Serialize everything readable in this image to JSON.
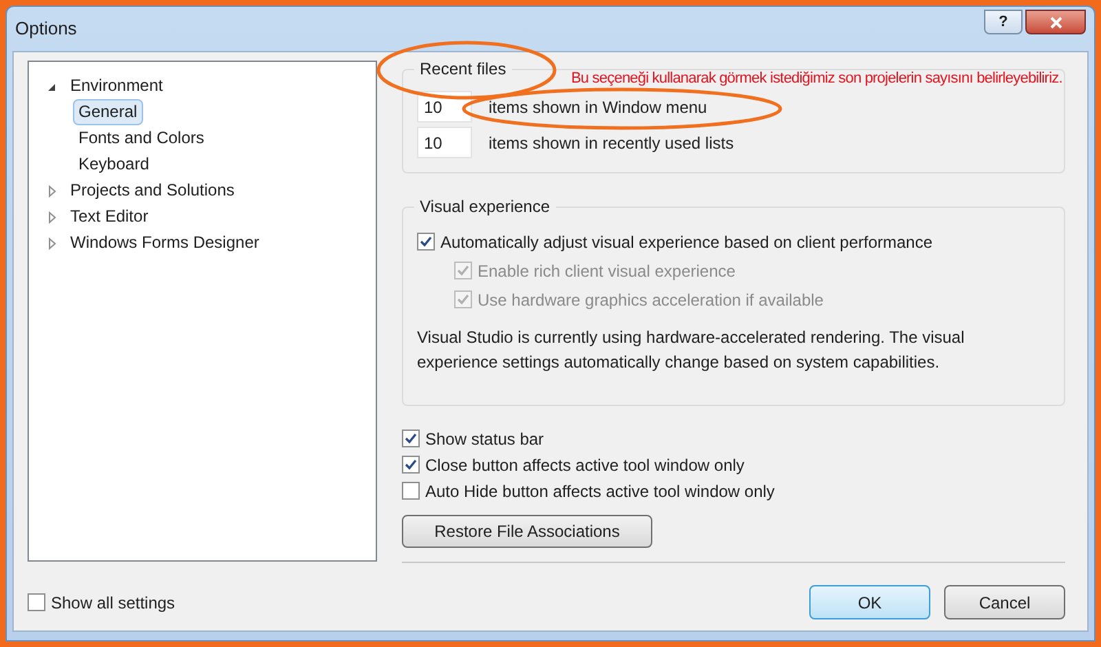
{
  "window": {
    "title": "Options",
    "help_button": "?"
  },
  "tree": [
    {
      "label": "Environment",
      "expanded": true,
      "selected": false,
      "children": [
        {
          "label": "General",
          "selected": true
        },
        {
          "label": "Fonts and Colors",
          "selected": false
        },
        {
          "label": "Keyboard",
          "selected": false
        }
      ]
    },
    {
      "label": "Projects and Solutions",
      "expanded": false,
      "selected": false
    },
    {
      "label": "Text Editor",
      "expanded": false,
      "selected": false
    },
    {
      "label": "Windows Forms Designer",
      "expanded": false,
      "selected": false
    }
  ],
  "recent_files": {
    "title": "Recent files",
    "rows": [
      {
        "value": "10",
        "label": "items shown in Window menu"
      },
      {
        "value": "10",
        "label": "items shown in recently used lists"
      }
    ]
  },
  "annotation": "Bu seçeneği kullanarak görmek istediğimiz son projelerin sayısını belirleyebiliriz.",
  "visual_experience": {
    "title": "Visual experience",
    "options": [
      {
        "label": "Automatically adjust visual experience based on client performance",
        "checked": true,
        "disabled": false,
        "indent": false
      },
      {
        "label": "Enable rich client visual experience",
        "checked": true,
        "disabled": true,
        "indent": true
      },
      {
        "label": "Use hardware graphics acceleration if available",
        "checked": true,
        "disabled": true,
        "indent": true
      }
    ],
    "note": "Visual Studio is currently using hardware-accelerated rendering. The visual experience settings automatically change based on system capabilities."
  },
  "options": [
    {
      "label": "Show status bar",
      "checked": true
    },
    {
      "label": "Close button affects active tool window only",
      "checked": true
    },
    {
      "label": "Auto Hide button affects active tool window only",
      "checked": false
    }
  ],
  "restore_button": "Restore File Associations",
  "show_all_settings": {
    "label": "Show all settings",
    "checked": false
  },
  "buttons": [
    {
      "label": "OK",
      "default": true
    },
    {
      "label": "Cancel",
      "default": false
    }
  ]
}
